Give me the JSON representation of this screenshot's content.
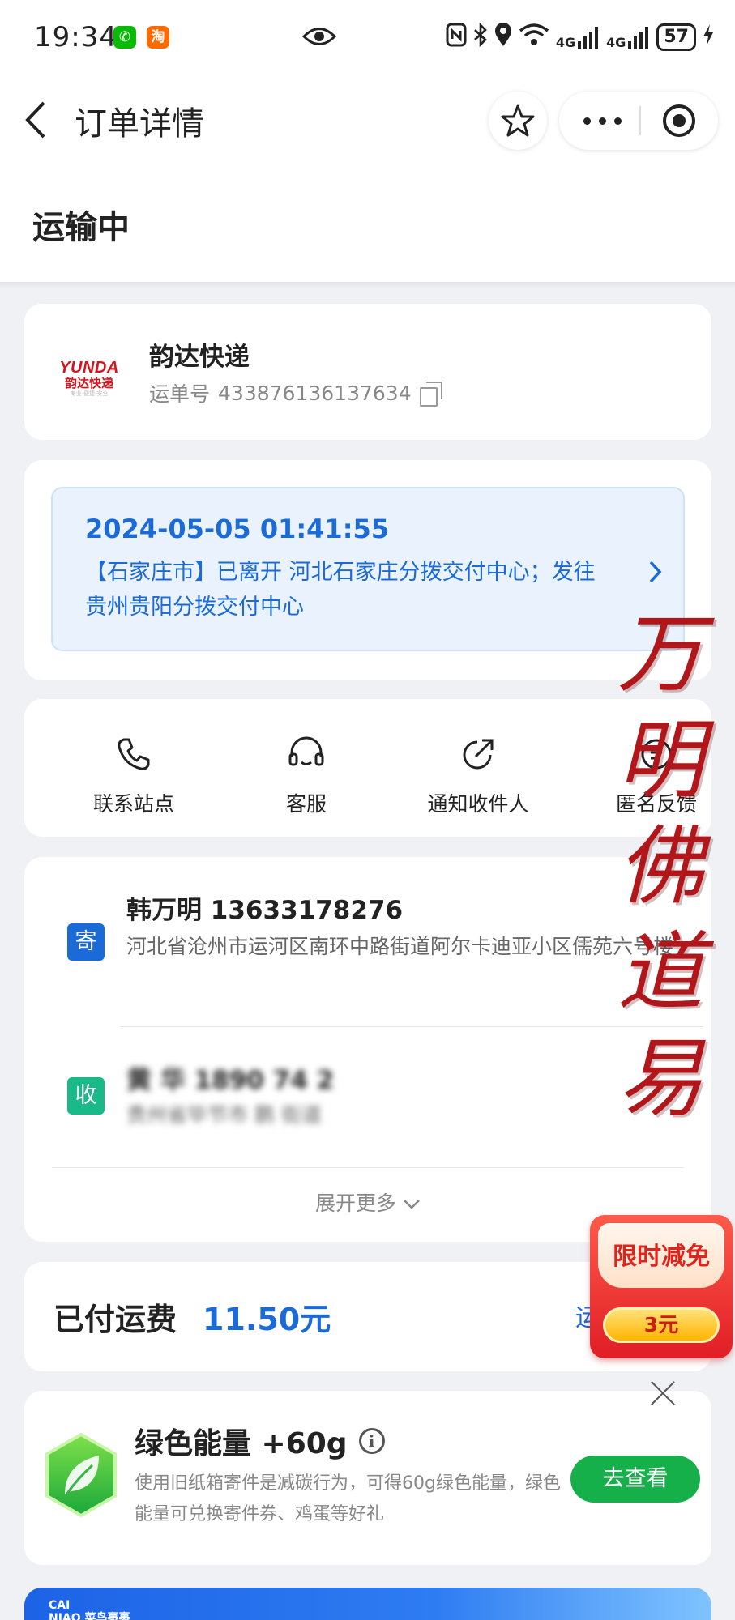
{
  "status_bar": {
    "time": "19:34",
    "wechat_badge": "✆",
    "taobao_badge": "淘",
    "net1": "4G",
    "net2": "4G",
    "battery": "57"
  },
  "nav": {
    "title": "订单详情"
  },
  "order": {
    "status": "运输中",
    "courier": {
      "logo_en": "YUNDA",
      "logo_cn": "韵达快递",
      "logo_slogan": "专业·便捷·安全",
      "name": "韵达快递",
      "waybill_label": "运单号",
      "waybill_no": "433876136137634"
    },
    "tracking": {
      "time": "2024-05-05 01:41:55",
      "text": "【石家庄市】已离开 河北石家庄分拨交付中心；发往 贵州贵阳分拨交付中心"
    }
  },
  "actions": [
    {
      "label": "联系站点",
      "icon": "phone-icon"
    },
    {
      "label": "客服",
      "icon": "headset-icon"
    },
    {
      "label": "通知收件人",
      "icon": "share-icon"
    },
    {
      "label": "匿名反馈",
      "icon": "feedback-icon"
    }
  ],
  "sender": {
    "badge": "寄",
    "name_phone": "韩万明 13633178276",
    "address": "河北省沧州市运河区南环中路街道阿尔卡迪亚小区儒苑六号楼"
  },
  "receiver": {
    "badge": "收",
    "name_phone": "黄  华 1890  74  2",
    "address": "贵州省毕节市           鹏        街道"
  },
  "expand_label": "展开更多",
  "fee": {
    "label": "已付运费",
    "value": "11.50元",
    "link": "运"
  },
  "promo": {
    "title": "限时减免",
    "amount": "3元"
  },
  "energy": {
    "title": "绿色能量 +60g",
    "info": "i",
    "desc": "使用旧纸箱寄件是减碳行为，可得60g绿色能量，绿色能量可兑换寄件券、鸡蛋等好礼",
    "button": "去查看"
  },
  "banner": {
    "logo_top": "CAI",
    "logo_bottom": "NIAO 菜鸟裹裹"
  },
  "overlay": {
    "chars": [
      "万",
      "明",
      "佛",
      "道",
      "易"
    ]
  },
  "colors": {
    "accent_blue": "#1a6ad8",
    "green": "#16b04a",
    "sender_badge": "#1a6ad8",
    "receiver_badge": "#19b98a",
    "brand_red": "#d4151c"
  }
}
